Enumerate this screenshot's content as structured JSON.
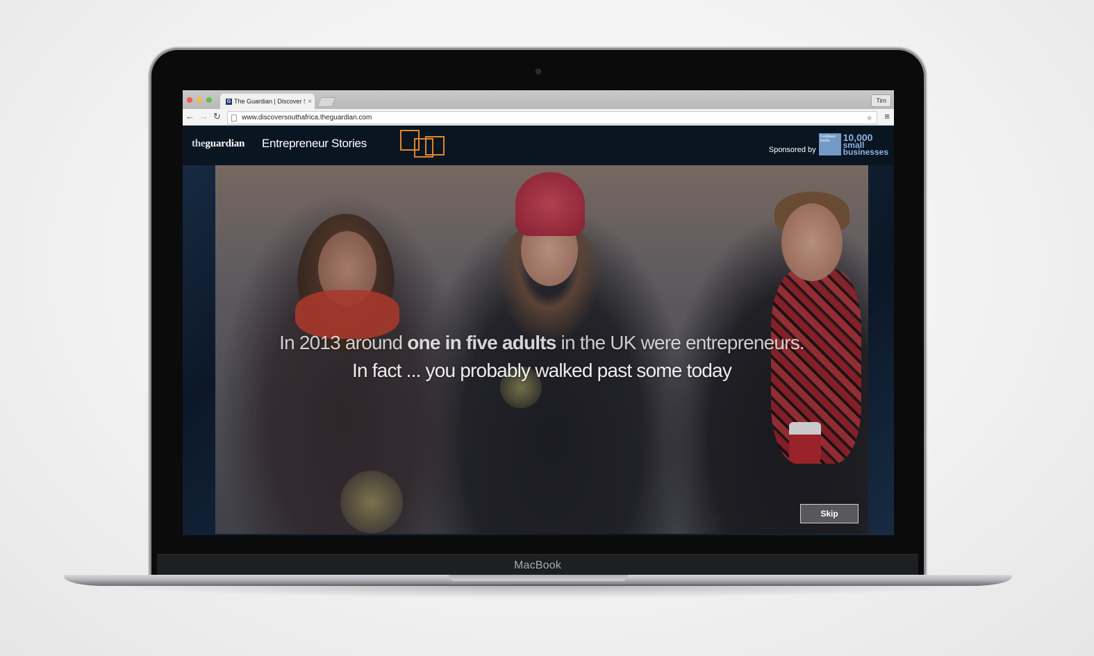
{
  "device": {
    "label": "MacBook"
  },
  "browser": {
    "tab_title": "The Guardian | Discover S",
    "tab_favicon": "G",
    "profile_name": "Tim",
    "url": "www.discoversouthafrica.theguardian.com",
    "icons": [
      "back-arrow-icon",
      "forward-arrow-icon",
      "reload-icon",
      "page-icon",
      "star-icon",
      "menu-icon"
    ]
  },
  "site": {
    "logo_the": "the",
    "logo_guardian": "guardian",
    "section_title": "Entrepreneur Stories",
    "sponsor_label": "Sponsored by",
    "sponsor_box_text": "Goldman Sachs",
    "sponsor_lines": [
      "10,000",
      "small",
      "businesses"
    ],
    "accent_color": "#e0862b"
  },
  "video": {
    "caption_line1_pre": "In 2013 around ",
    "caption_line1_bold": "one in five adults",
    "caption_line1_post": " in the UK were entrepreneurs.",
    "caption_line2": "In fact ... you probably walked past some today",
    "skip_label": "Skip"
  }
}
